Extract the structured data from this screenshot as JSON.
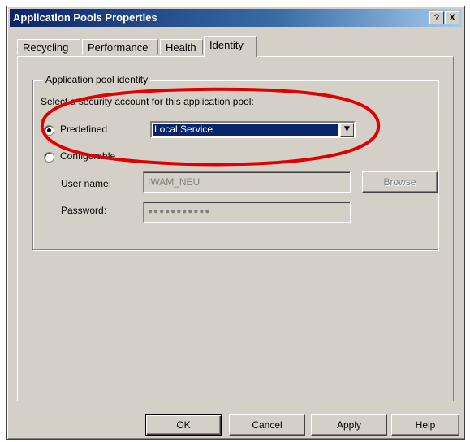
{
  "window": {
    "title": "Application Pools Properties"
  },
  "titlebar_buttons": {
    "help": "?",
    "close": "X"
  },
  "tabs": [
    {
      "label": "Recycling"
    },
    {
      "label": "Performance"
    },
    {
      "label": "Health"
    },
    {
      "label": "Identity"
    }
  ],
  "active_tab": "Identity",
  "group": {
    "label": "Application pool identity",
    "instruction": "Select a security account for this application pool:",
    "predefined_label": "Predefined",
    "predefined_selected": true,
    "predefined_value": "Local Service",
    "configurable_label": "Configurable",
    "configurable_selected": false,
    "username_label": "User name:",
    "username_value": "IWAM_NEU",
    "password_label": "Password:",
    "password_value": "●●●●●●●●●●●",
    "browse_label": "Browse"
  },
  "footer": {
    "ok": "OK",
    "cancel": "Cancel",
    "apply": "Apply",
    "help": "Help"
  },
  "colors": {
    "dialog_bg": "#d4d0c8",
    "titlebar_start": "#0a246a",
    "selection": "#0a246a",
    "annotation_circle": "#e00000"
  },
  "icons": {
    "dropdown": "chevron-down-icon"
  }
}
